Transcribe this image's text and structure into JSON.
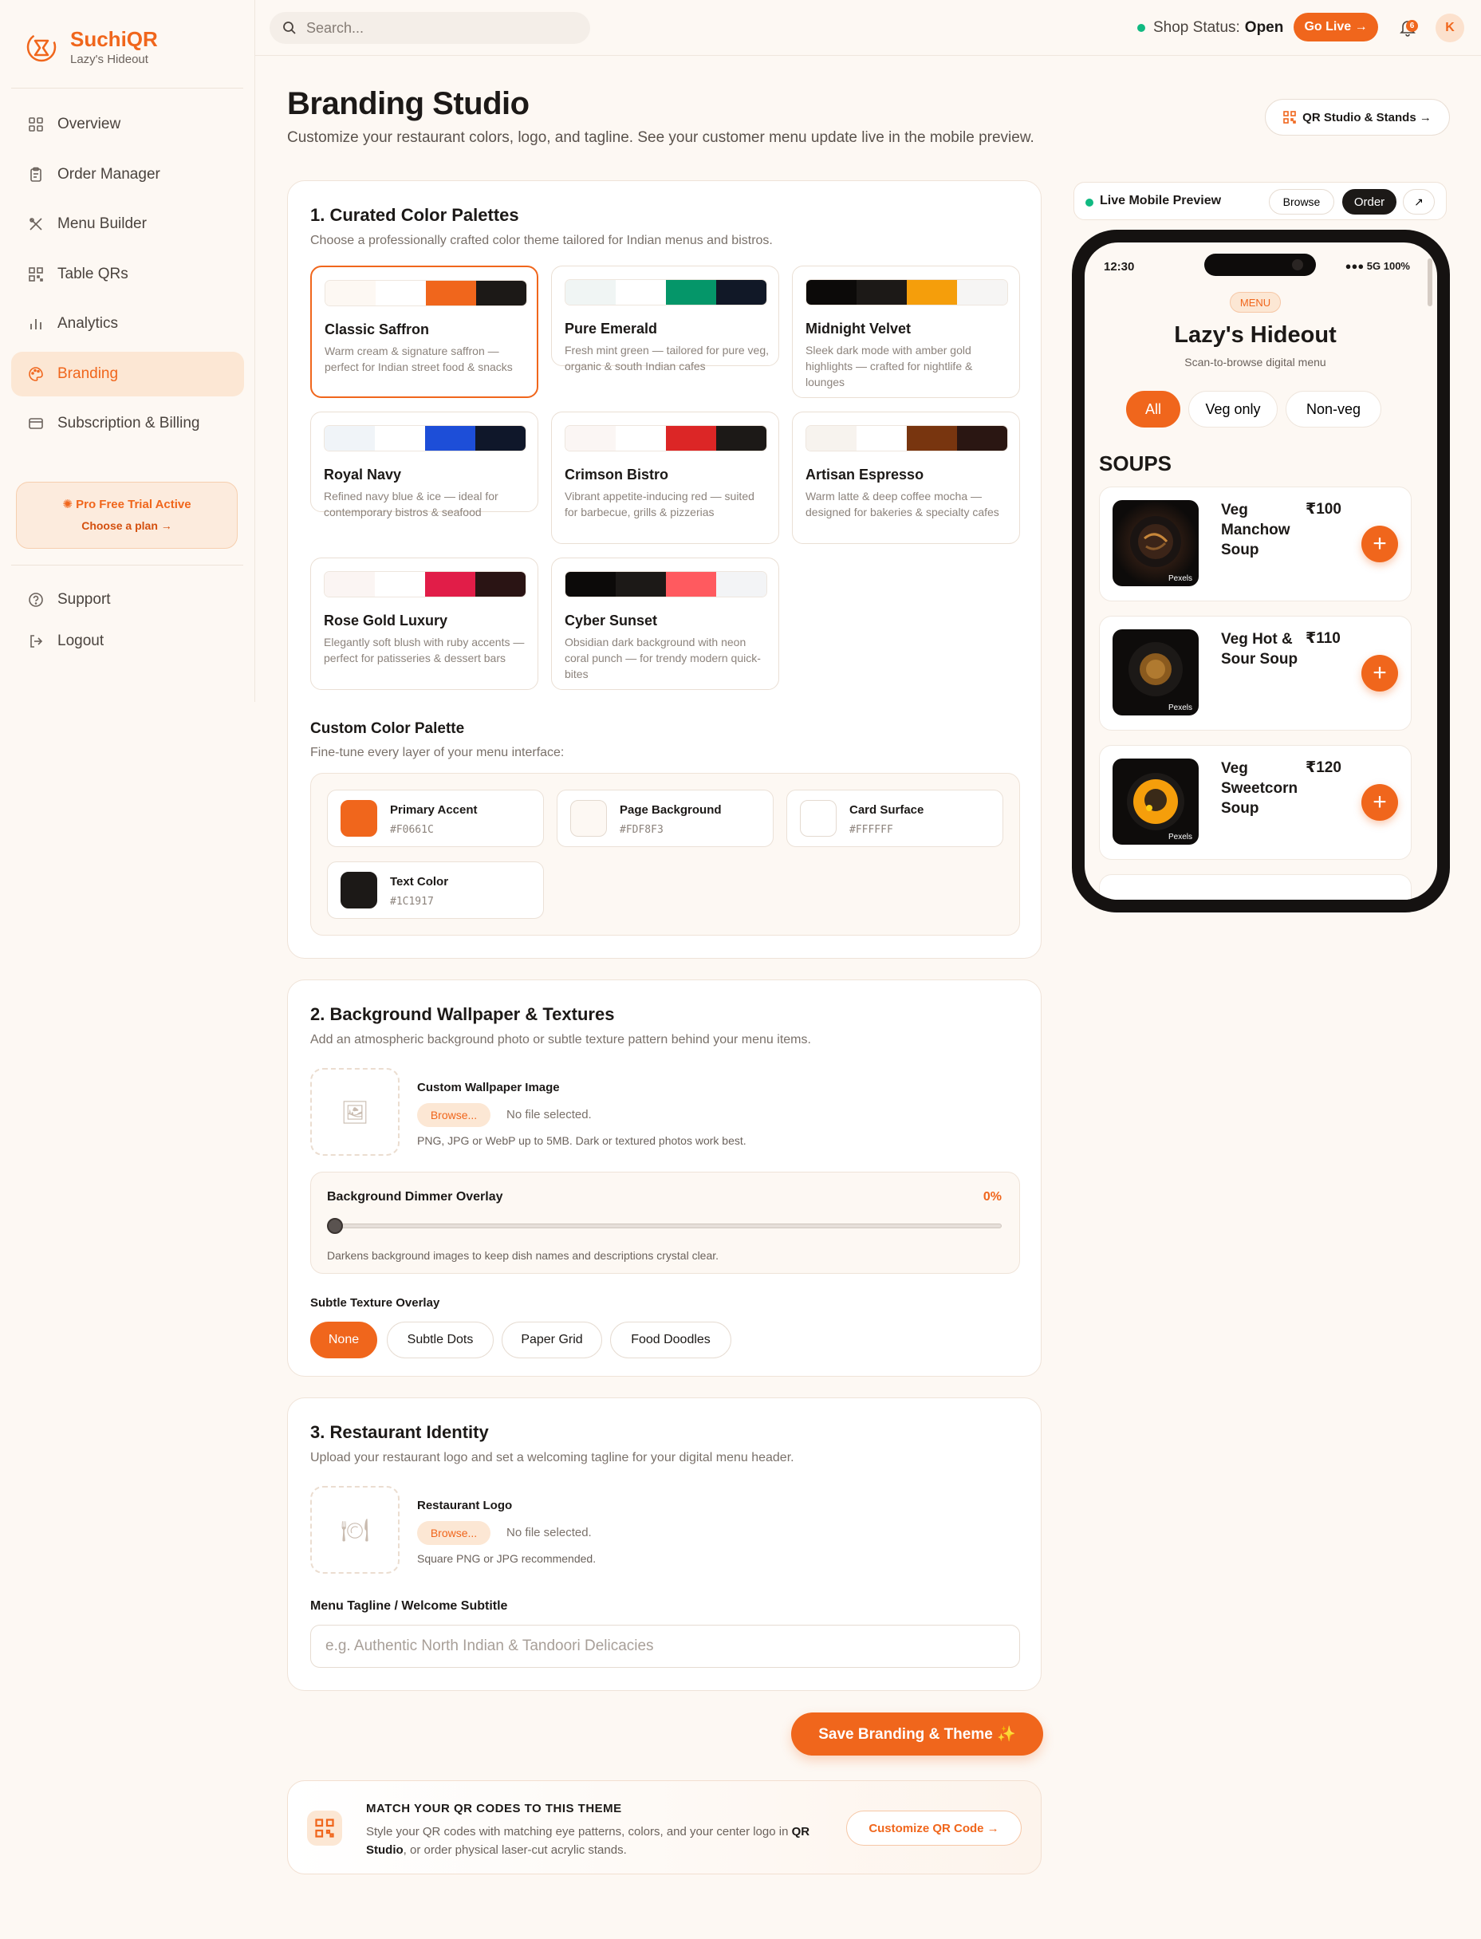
{
  "brand": {
    "name": "SuchiQR",
    "subtitle": "Lazy's Hideout"
  },
  "sidebar": {
    "items": [
      {
        "label": "Overview",
        "icon": "grid-icon"
      },
      {
        "label": "Order Manager",
        "icon": "clipboard-icon"
      },
      {
        "label": "Menu Builder",
        "icon": "utensils-icon"
      },
      {
        "label": "Table QRs",
        "icon": "qr-icon"
      },
      {
        "label": "Analytics",
        "icon": "bar-chart-icon"
      },
      {
        "label": "Branding",
        "icon": "palette-icon",
        "active": true
      },
      {
        "label": "Subscription & Billing",
        "icon": "credit-card-icon"
      }
    ],
    "trial": {
      "title": "Pro Free Trial Active",
      "link": "Choose a plan →"
    },
    "bottom": [
      {
        "label": "Support",
        "icon": "help-icon"
      },
      {
        "label": "Logout",
        "icon": "logout-icon"
      }
    ]
  },
  "topbar": {
    "search_placeholder": "Search...",
    "status_label": "Shop Status:",
    "status_value": "Open",
    "go_live": "Go Live →",
    "notification_count": "6",
    "avatar_initial": "K"
  },
  "header": {
    "title": "Branding Studio",
    "subtitle": "Customize your restaurant colors, logo, and tagline. See your customer menu update live in the mobile preview.",
    "qr_button": "QR Studio & Stands →"
  },
  "section1": {
    "title": "1. Curated Color Palettes",
    "subtitle": "Choose a professionally crafted color theme tailored for Indian menus and bistros.",
    "palettes": [
      {
        "name": "Classic Saffron",
        "desc": "Warm cream & signature saffron — perfect for Indian street food & snacks",
        "colors": [
          "#FDF8F3",
          "#FFFFFF",
          "#F0661C",
          "#1C1917"
        ],
        "selected": true
      },
      {
        "name": "Pure Emerald",
        "desc": "Fresh mint green — tailored for pure veg, organic & south Indian cafes",
        "colors": [
          "#F0F5F4",
          "#FFFFFF",
          "#059669",
          "#111827"
        ]
      },
      {
        "name": "Midnight Velvet",
        "desc": "Sleek dark mode with amber gold highlights — crafted for nightlife & lounges",
        "colors": [
          "#0C0A09",
          "#1C1917",
          "#F59E0B",
          "#F6F5F4"
        ]
      },
      {
        "name": "Royal Navy",
        "desc": "Refined navy blue & ice — ideal for contemporary bistros & seafood",
        "colors": [
          "#F0F4F8",
          "#FFFFFF",
          "#1D4ED8",
          "#0F172A"
        ]
      },
      {
        "name": "Crimson Bistro",
        "desc": "Vibrant appetite-inducing red — suited for barbecue, grills & pizzerias",
        "colors": [
          "#FBF6F4",
          "#FFFFFF",
          "#DC2626",
          "#1C1917"
        ]
      },
      {
        "name": "Artisan Espresso",
        "desc": "Warm latte & deep coffee mocha — designed for bakeries & specialty cafes",
        "colors": [
          "#F7F3EE",
          "#FFFFFF",
          "#78350F",
          "#2A1612"
        ]
      },
      {
        "name": "Rose Gold Luxury",
        "desc": "Elegantly soft blush with ruby accents — perfect for patisseries & dessert bars",
        "colors": [
          "#FBF5F3",
          "#FFFFFF",
          "#E11D48",
          "#2A1414"
        ]
      },
      {
        "name": "Cyber Sunset",
        "desc": "Obsidian dark background with neon coral punch — for trendy modern quick-bites",
        "colors": [
          "#0C0A09",
          "#1C1917",
          "#FF5A5F",
          "#F3F4F6"
        ]
      }
    ],
    "custom": {
      "title": "Custom Color Palette",
      "subtitle": "Fine-tune every layer of your menu interface:",
      "fields": [
        {
          "label": "Primary Accent",
          "hex": "#F0661C"
        },
        {
          "label": "Page Background",
          "hex": "#FDF8F3"
        },
        {
          "label": "Card Surface",
          "hex": "#FFFFFF"
        },
        {
          "label": "Text Color",
          "hex": "#1C1917"
        }
      ]
    }
  },
  "section2": {
    "title": "2. Background Wallpaper & Textures",
    "subtitle": "Add an atmospheric background photo or subtle texture pattern behind your menu items.",
    "upload_label": "Custom Wallpaper Image",
    "browse": "Browse...",
    "no_file": "No file selected.",
    "hint": "PNG, JPG or WebP up to 5MB. Dark or textured photos work best.",
    "dimmer_label": "Background Dimmer Overlay",
    "dimmer_value": "0%",
    "dimmer_fraction": 0,
    "dimmer_hint": "Darkens background images to keep dish names and descriptions crystal clear.",
    "texture_label": "Subtle Texture Overlay",
    "textures": [
      "None",
      "Subtle Dots",
      "Paper Grid",
      "Food Doodles"
    ]
  },
  "section3": {
    "title": "3. Restaurant Identity",
    "subtitle": "Upload your restaurant logo and set a welcoming tagline for your digital menu header.",
    "upload_label": "Restaurant Logo",
    "browse": "Browse...",
    "no_file": "No file selected.",
    "hint": "Square PNG or JPG recommended.",
    "tagline_label": "Menu Tagline / Welcome Subtitle",
    "tagline_placeholder": "e.g. Authentic North Indian & Tandoori Delicacies"
  },
  "save_button": "Save Branding & Theme ✨",
  "match": {
    "title": "MATCH YOUR QR CODES TO THIS THEME",
    "desc_1": "Style your QR codes with matching eye patterns, colors, and your center logo in ",
    "desc_bold": "QR Studio",
    "desc_2": ", or order physical laser-cut acrylic stands.",
    "button": "Customize QR Code →"
  },
  "preview": {
    "label": "Live Mobile Preview",
    "browse": "Browse",
    "order": "Order",
    "expand": "↗",
    "time": "12:30",
    "signal": "●●● 5G 100%",
    "menu_pill": "MENU",
    "restaurant": "Lazy's Hideout",
    "tagline": "Scan-to-browse digital menu",
    "filters": [
      "All",
      "Veg only",
      "Non-veg"
    ],
    "category": "SOUPS",
    "dishes": [
      {
        "name": "Veg Manchow Soup",
        "price": "₹100",
        "tag": "Pexels"
      },
      {
        "name": "Veg Hot & Sour Soup",
        "price": "₹110",
        "tag": "Pexels"
      },
      {
        "name": "Veg Sweetcorn Soup",
        "price": "₹120",
        "tag": "Pexels"
      }
    ]
  }
}
